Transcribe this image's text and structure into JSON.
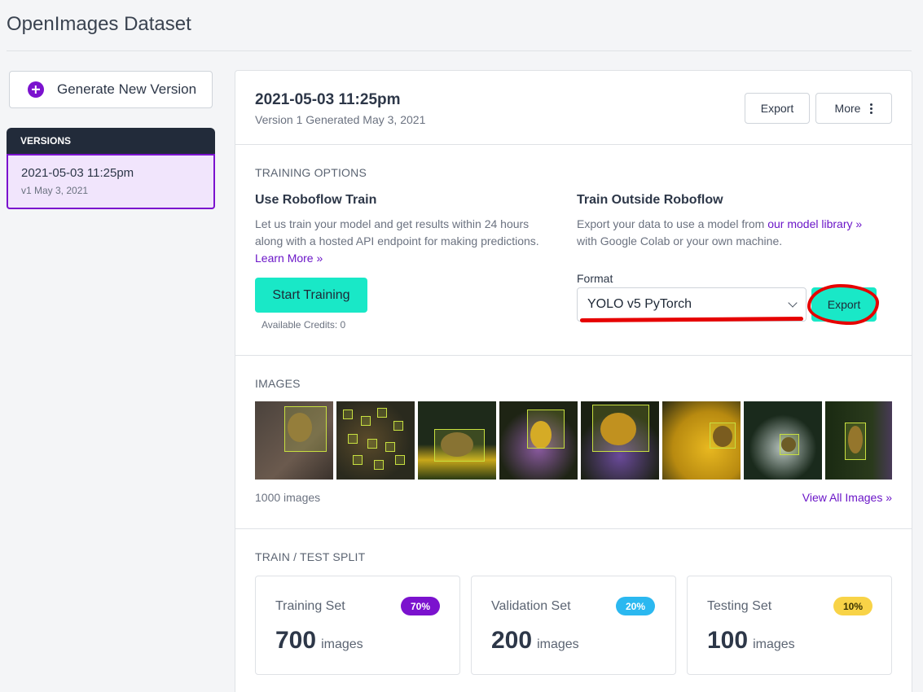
{
  "page": {
    "title": "OpenImages Dataset"
  },
  "sidebar": {
    "generate_label": "Generate New Version",
    "versions_header": "VERSIONS",
    "versions": [
      {
        "title": "2021-05-03 11:25pm",
        "subtitle": "v1 May 3, 2021"
      }
    ]
  },
  "header": {
    "title": "2021-05-03 11:25pm",
    "subtitle": "Version 1 Generated May 3, 2021",
    "export_label": "Export",
    "more_label": "More"
  },
  "training": {
    "section_label": "TRAINING OPTIONS",
    "left": {
      "title": "Use Roboflow Train",
      "text": "Let us train your model and get results within 24 hours along with a hosted API endpoint for making predictions.",
      "link": "Learn More »",
      "button": "Start Training",
      "credits": "Available Credits: 0"
    },
    "right": {
      "title": "Train Outside Roboflow",
      "text_before": "Export your data to use a model from",
      "link": "our model library »",
      "text_after": "with Google Colab or your own machine.",
      "format_label": "Format",
      "format_value": "YOLO v5 PyTorch",
      "export_button": "Export"
    }
  },
  "images": {
    "section_label": "IMAGES",
    "count_text": "1000 images",
    "view_all": "View All Images »"
  },
  "split": {
    "section_label": "TRAIN / TEST SPLIT",
    "cards": [
      {
        "name": "Training Set",
        "badge": "70%",
        "count": "700",
        "unit": "images",
        "badge_bg": "#7b12ce",
        "badge_fg": "#ffffff"
      },
      {
        "name": "Validation Set",
        "badge": "20%",
        "count": "200",
        "unit": "images",
        "badge_bg": "#2bb8f0",
        "badge_fg": "#ffffff"
      },
      {
        "name": "Testing Set",
        "badge": "10%",
        "count": "100",
        "unit": "images",
        "badge_bg": "#f8d347",
        "badge_fg": "#3a3300"
      }
    ]
  },
  "annotations": {
    "color": "#e60000"
  }
}
